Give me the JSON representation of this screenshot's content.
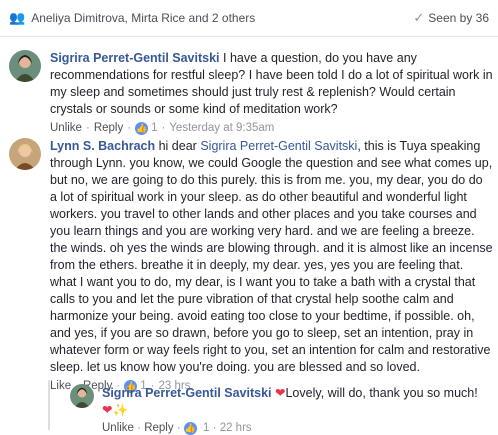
{
  "header": {
    "people_icon": "people-icon",
    "participants": "Aneliya Dimitrova, Mirta Rice and 2 others",
    "seen_icon": "check-icon",
    "seen_text": "Seen by 36"
  },
  "comments": [
    {
      "author": "Sigrira Perret-Gentil Savitski",
      "text": "I have a question, do you have any recommendations for restful sleep? I have been told I do a lot of spiritual work in my sleep and sometimes should just truly rest & replenish? Would certain crystals or sounds or some kind of meditation work?",
      "unlike": "Unlike",
      "reply": "Reply",
      "like_count": "1",
      "time": "Yesterday at 9:35am"
    },
    {
      "author": "Lynn S. Bachrach",
      "text_before": "hi dear",
      "mention": "Sigrira Perret-Gentil Savitski",
      "text_after": ", this is Tuya speaking through Lynn. you know, we could Google the question and see what comes up, but no, we are going to do this purely. this is from me. you, my dear, you do do a lot of spiritual work in your sleep. as do other beautiful and wonderful light workers. you travel to other lands and other places and you take courses and you learn things and you are working very hard. and we are feeling a breeze. the winds. oh yes the winds are blowing through. and it is almost like an incense from the ethers. breathe it in deeply, my dear. yes, yes you are feeling that. what I want you to do, my dear, is I want you to take a bath with a crystal that calls to you and let the pure vibration of that crystal help soothe calm and harmonize your being. avoid eating too close to your bedtime, if possible. oh, and yes, if you are so drawn, before you go to sleep, set an intention, pray in whatever form or way feels right to you, set an intention for calm and restorative sleep. let us know how you're doing. you are blessed and so loved.",
      "like": "Like",
      "reply": "Reply",
      "like_count": "1",
      "time": "23 hrs"
    }
  ],
  "reply": {
    "author": "Sigrira Perret-Gentil Savitski",
    "text": "Lovely, will do, thank you so much!",
    "unlike": "Unlike",
    "reply": "Reply",
    "like_count": "1",
    "time": "22 hrs"
  },
  "colors": {
    "link": "#365899",
    "like": "#5890ff",
    "heart": "#e8344d"
  }
}
